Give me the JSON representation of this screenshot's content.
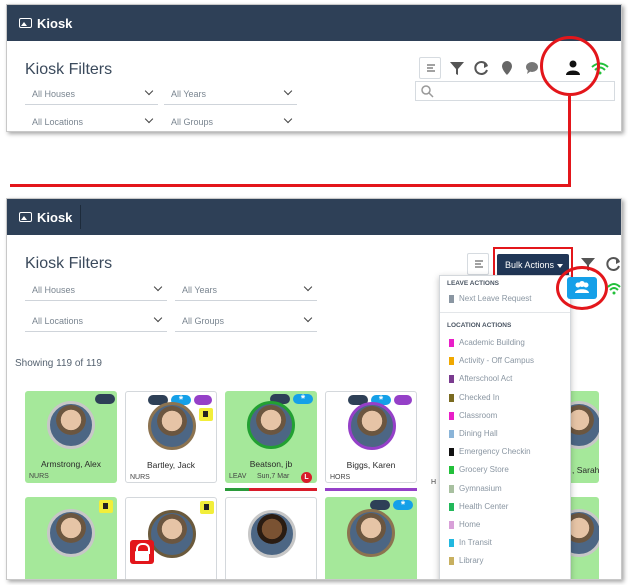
{
  "app": {
    "title": "Kiosk"
  },
  "filters": {
    "title": "Kiosk Filters",
    "houses": "All Houses",
    "years": "All Years",
    "locations": "All Locations",
    "groups": "All Groups"
  },
  "toolbar": {
    "bulk_actions": "Bulk Actions",
    "icons": [
      "list-icon",
      "filter-icon",
      "refresh-icon",
      "location-pin-icon",
      "comment-icon",
      "person-icon",
      "wifi-icon"
    ]
  },
  "showing": "Showing 119 of 119",
  "menu": {
    "leave_header": "LEAVE ACTIONS",
    "leave_items": [
      {
        "label": "Next Leave Request",
        "color": "#8a96a2"
      }
    ],
    "location_header": "LOCATION ACTIONS",
    "location_items": [
      {
        "label": "Academic Building",
        "color": "#e91ec8"
      },
      {
        "label": "Activity - Off Campus",
        "color": "#f0a800"
      },
      {
        "label": "Afterschool Act",
        "color": "#7a3b8f"
      },
      {
        "label": "Checked In",
        "color": "#7a6a20"
      },
      {
        "label": "Classroom",
        "color": "#e91ec8"
      },
      {
        "label": "Dining Hall",
        "color": "#8ab4d8"
      },
      {
        "label": "Emergency Checkin",
        "color": "#111111"
      },
      {
        "label": "Grocery Store",
        "color": "#22c03a"
      },
      {
        "label": "Gymnasium",
        "color": "#a8c0a0"
      },
      {
        "label": "Health Center",
        "color": "#22b85a"
      },
      {
        "label": "Home",
        "color": "#d8a0d8"
      },
      {
        "label": "In Transit",
        "color": "#22b8e0"
      },
      {
        "label": "Library",
        "color": "#c8b060"
      }
    ]
  },
  "students_row1": [
    {
      "name": "Armstrong, Alex",
      "house": "NURS"
    },
    {
      "name": "Bartley, Jack",
      "house": "NURS"
    },
    {
      "name": "Beatson, jb",
      "house": "LEAV",
      "sub": "Sun,7 Mar",
      "badge": "L"
    },
    {
      "name": "Biggs, Karen",
      "house": "HORS"
    }
  ],
  "partial": {
    "sarah": ", Sarah",
    "hp": "H"
  },
  "colors": {
    "brand": "#2e4057",
    "accent": "#15a0e8",
    "highlight": "#e3161b",
    "present": "#a5e89a"
  }
}
